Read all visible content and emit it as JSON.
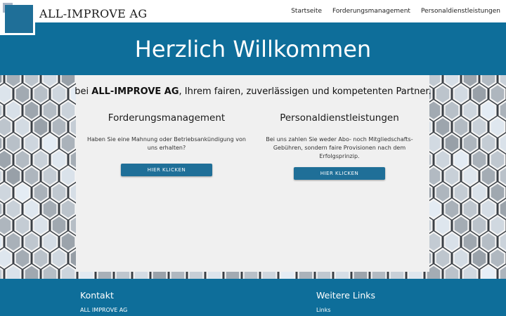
{
  "header": {
    "brand": "ALL-IMPROVE AG",
    "nav": [
      "Startseite",
      "Forderungsmanagement",
      "Personaldienstleistungen"
    ]
  },
  "hero": {
    "title": "Herzlich Willkommen"
  },
  "intro": {
    "prefix": "bei ",
    "company": "ALL-IMPROVE AG",
    "suffix": ", Ihrem fairen, zuverlässigen und kompetenten Partner."
  },
  "services": [
    {
      "title": "Forderungsmanagement",
      "text": "Haben Sie eine Mahnung oder Betriebsankündigung von uns erhalten?",
      "button": "HIER KLICKEN"
    },
    {
      "title": "Personaldienstleistungen",
      "text": "Bei uns zahlen Sie weder Abo- noch Mitgliedschafts-Gebühren, sondern faire Provisionen nach dem Erfolgsprinzip.",
      "button": "HIER KLICKEN"
    }
  ],
  "footer": {
    "contact_title": "Kontakt",
    "contact_lines": [
      "ALL IMPROVE AG"
    ],
    "links_title": "Weitere Links",
    "links": [
      "Links"
    ]
  },
  "colors": {
    "brand_blue": "#0e6e9a",
    "button_blue": "#1f6f98",
    "card_bg": "#f0f0f0"
  }
}
